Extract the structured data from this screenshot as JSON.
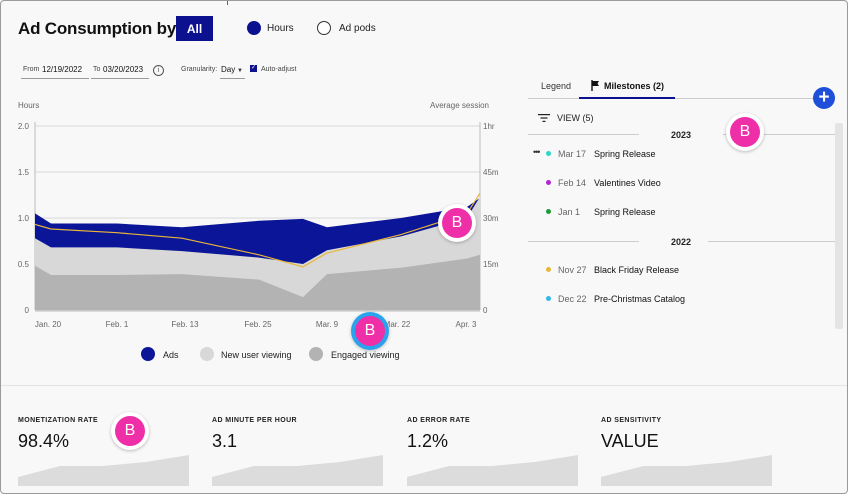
{
  "header": {
    "title": "Ad Consumption by",
    "all_button": "All",
    "radio_hours": "Hours",
    "radio_ad_pods": "Ad pods"
  },
  "filters": {
    "from_label": "From",
    "from_value": "12/19/2022",
    "to_label": "To",
    "to_value": "03/20/2023",
    "info_icon": "info-icon",
    "granularity_label": "Granularity:",
    "granularity_value": "Day",
    "auto_adjust_label": "Auto-adjust",
    "auto_adjust_checked": true
  },
  "chart_data": {
    "type": "area",
    "ylabel": "Hours",
    "y2label": "Average session",
    "ylim": [
      0,
      2.0
    ],
    "yticks": [
      "2.0",
      "1.5",
      "1.0",
      "0.5",
      "0"
    ],
    "y2ticks": [
      "1hr",
      "45m",
      "30m",
      "15m",
      "0"
    ],
    "x_ticks": [
      "Jan. 20",
      "Feb. 1",
      "Feb. 13",
      "Feb. 25",
      "Mar. 9",
      "Mar. 22",
      "Apr. 3"
    ],
    "x_points": [
      "Jan. 14",
      "Jan. 20",
      "Feb. 1",
      "Feb. 13",
      "Feb. 25",
      "Mar. 1",
      "Mar. 9",
      "Mar. 22",
      "Apr. 3",
      "Apr. 7"
    ],
    "grid": true,
    "legend_position": "bottom",
    "series": [
      {
        "name": "Ads",
        "color": "#0b1597",
        "values": [
          1.05,
          0.94,
          0.94,
          0.9,
          0.97,
          0.99,
          0.9,
          1.0,
          1.12,
          1.22
        ]
      },
      {
        "name": "New user viewing",
        "color": "#d8d8d8",
        "values": [
          0.78,
          0.68,
          0.68,
          0.64,
          0.57,
          0.5,
          0.65,
          0.8,
          1.0,
          1.23
        ]
      },
      {
        "name": "Engaged viewing",
        "color": "#b3b3b3",
        "values": [
          0.48,
          0.38,
          0.38,
          0.39,
          0.33,
          0.14,
          0.39,
          0.46,
          0.56,
          0.6
        ]
      },
      {
        "name": "Average session",
        "color": "#e8b63a",
        "axis": "right",
        "values": [
          0.93,
          0.88,
          0.84,
          0.78,
          0.6,
          0.47,
          0.62,
          0.82,
          1.05,
          1.27
        ]
      }
    ]
  },
  "legend": {
    "ads": "Ads",
    "new_user": "New user viewing",
    "engaged": "Engaged viewing"
  },
  "panel": {
    "tab_legend": "Legend",
    "tab_milestones": "Milestones (2)",
    "add_icon": "plus-icon",
    "view_label": "VIEW (5)",
    "groups": [
      {
        "year": "2023",
        "items": [
          {
            "date": "Mar 17",
            "name": "Spring Release",
            "color": "#2ad6c9"
          },
          {
            "date": "Feb 14",
            "name": "Valentines Video",
            "color": "#b328d6"
          },
          {
            "date": "Jan 1",
            "name": "Spring Release",
            "color": "#1f9a3a"
          }
        ]
      },
      {
        "year": "2022",
        "items": [
          {
            "date": "Nov 27",
            "name": "Black Friday Release",
            "color": "#e8b63a"
          },
          {
            "date": "Dec 22",
            "name": "Pre-Christmas Catalog",
            "color": "#35b8e8"
          }
        ]
      }
    ]
  },
  "metrics": [
    {
      "label": "MONETIZATION RATE",
      "value": "98.4%"
    },
    {
      "label": "AD MINUTE PER HOUR",
      "value": "3.1"
    },
    {
      "label": "AD ERROR RATE",
      "value": "1.2%"
    },
    {
      "label": "AD SENSITIVITY",
      "value": "VALUE"
    }
  ],
  "badges": [
    "B",
    "B",
    "B",
    "B"
  ]
}
